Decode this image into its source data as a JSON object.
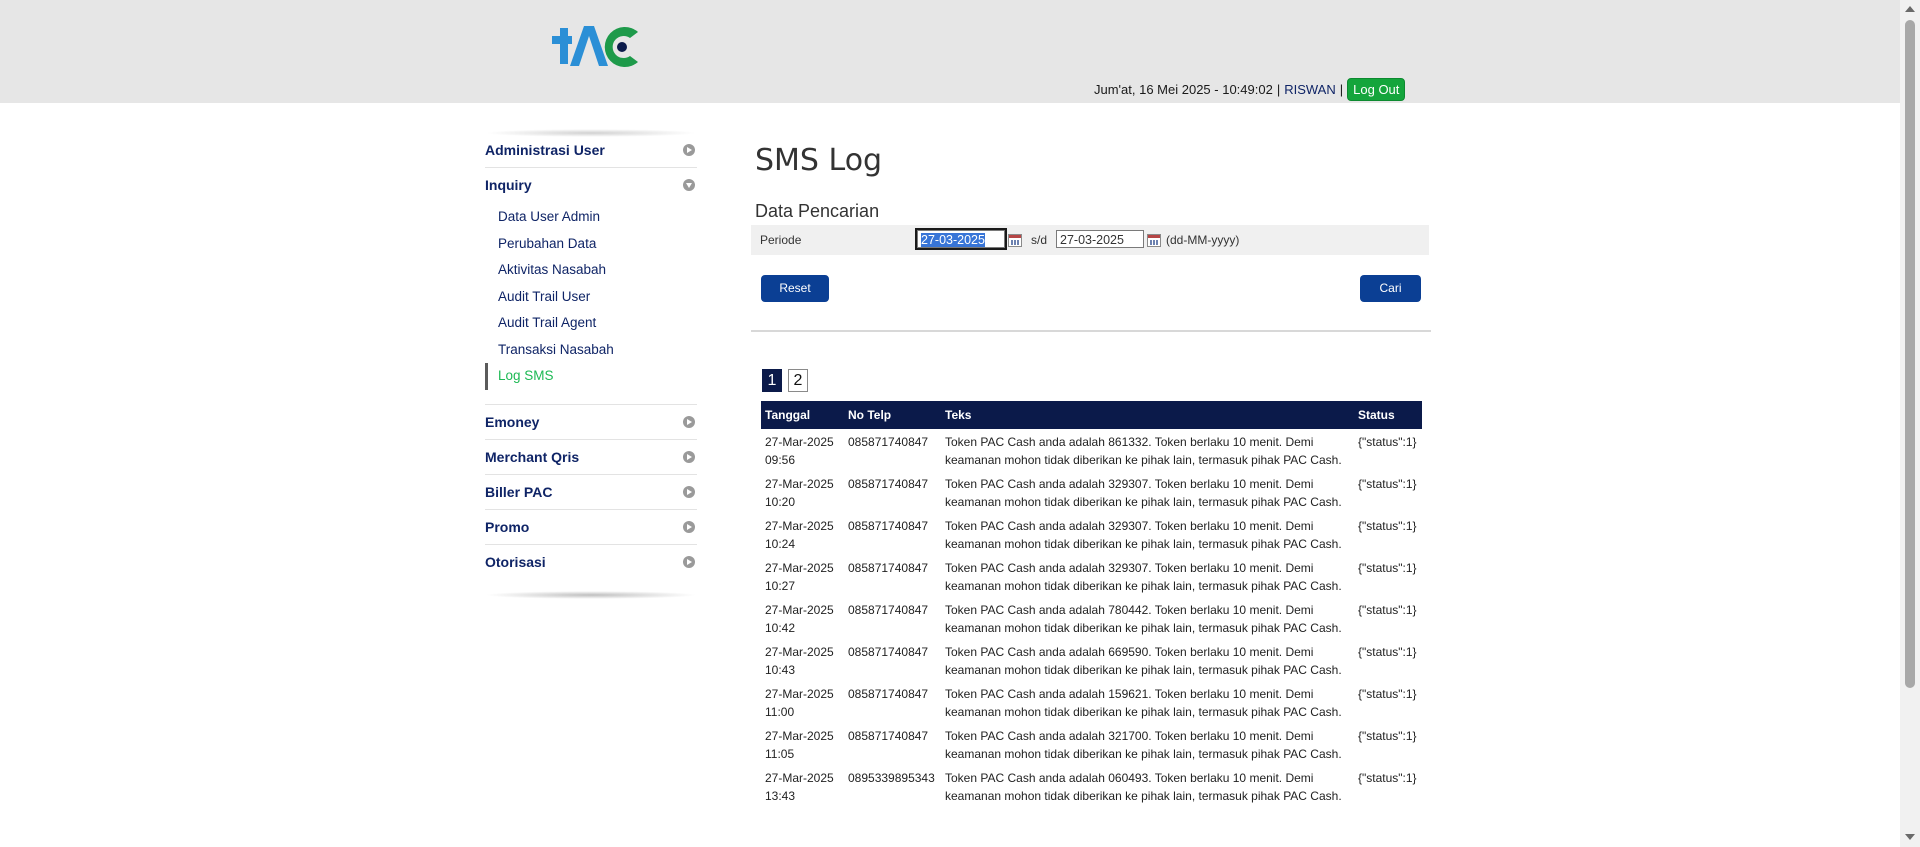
{
  "header": {
    "logo_text": "PAC",
    "datetime": "Jum'at, 16 Mei 2025 - 10:49:02",
    "sep1": "|",
    "username": "RISWAN",
    "sep2": "|",
    "logout_label": "Log Out"
  },
  "sidebar": {
    "menus": [
      {
        "label": "Administrasi User"
      },
      {
        "label": "Inquiry"
      },
      {
        "label": "Emoney"
      },
      {
        "label": "Merchant Qris"
      },
      {
        "label": "Biller PAC"
      },
      {
        "label": "Promo"
      },
      {
        "label": "Otorisasi"
      }
    ],
    "inquiry_items": [
      {
        "label": "Data User Admin"
      },
      {
        "label": "Perubahan Data"
      },
      {
        "label": "Aktivitas Nasabah"
      },
      {
        "label": "Audit Trail User"
      },
      {
        "label": "Audit Trail Agent"
      },
      {
        "label": "Transaksi Nasabah"
      },
      {
        "label": "Log SMS"
      }
    ]
  },
  "main": {
    "title": "SMS Log",
    "section": "Data Pencarian",
    "periode_label": "Periode",
    "date_from": "27-03-2025",
    "sd_label": "s/d",
    "date_to": "27-03-2025",
    "date_format": "(dd-MM-yyyy)",
    "reset_label": "Reset",
    "search_label": "Cari",
    "pages": [
      "1",
      "2"
    ],
    "columns": [
      "Tanggal",
      "No Telp",
      "Teks",
      "Status"
    ],
    "rows": [
      {
        "date1": "27-Mar-2025",
        "date2": "09:56",
        "phone": "085871740847",
        "text1": "Token PAC Cash anda adalah 861332. Token berlaku 10 menit. Demi",
        "text2": "keamanan mohon tidak diberikan ke pihak lain, termasuk pihak PAC Cash.",
        "status": "{\"status\":1}"
      },
      {
        "date1": "27-Mar-2025",
        "date2": "10:20",
        "phone": "085871740847",
        "text1": "Token PAC Cash anda adalah 329307. Token berlaku 10 menit. Demi",
        "text2": "keamanan mohon tidak diberikan ke pihak lain, termasuk pihak PAC Cash.",
        "status": "{\"status\":1}"
      },
      {
        "date1": "27-Mar-2025",
        "date2": "10:24",
        "phone": "085871740847",
        "text1": "Token PAC Cash anda adalah 329307. Token berlaku 10 menit. Demi",
        "text2": "keamanan mohon tidak diberikan ke pihak lain, termasuk pihak PAC Cash.",
        "status": "{\"status\":1}"
      },
      {
        "date1": "27-Mar-2025",
        "date2": "10:27",
        "phone": "085871740847",
        "text1": "Token PAC Cash anda adalah 329307. Token berlaku 10 menit. Demi",
        "text2": "keamanan mohon tidak diberikan ke pihak lain, termasuk pihak PAC Cash.",
        "status": "{\"status\":1}"
      },
      {
        "date1": "27-Mar-2025",
        "date2": "10:42",
        "phone": "085871740847",
        "text1": "Token PAC Cash anda adalah 780442. Token berlaku 10 menit. Demi",
        "text2": "keamanan mohon tidak diberikan ke pihak lain, termasuk pihak PAC Cash.",
        "status": "{\"status\":1}"
      },
      {
        "date1": "27-Mar-2025",
        "date2": "10:43",
        "phone": "085871740847",
        "text1": "Token PAC Cash anda adalah 669590. Token berlaku 10 menit. Demi",
        "text2": "keamanan mohon tidak diberikan ke pihak lain, termasuk pihak PAC Cash.",
        "status": "{\"status\":1}"
      },
      {
        "date1": "27-Mar-2025",
        "date2": "11:00",
        "phone": "085871740847",
        "text1": "Token PAC Cash anda adalah 159621. Token berlaku 10 menit. Demi",
        "text2": "keamanan mohon tidak diberikan ke pihak lain, termasuk pihak PAC Cash.",
        "status": "{\"status\":1}"
      },
      {
        "date1": "27-Mar-2025",
        "date2": "11:05",
        "phone": "085871740847",
        "text1": "Token PAC Cash anda adalah 321700. Token berlaku 10 menit. Demi",
        "text2": "keamanan mohon tidak diberikan ke pihak lain, termasuk pihak PAC Cash.",
        "status": "{\"status\":1}"
      },
      {
        "date1": "27-Mar-2025",
        "date2": "13:43",
        "phone": "0895339895343",
        "text1": "Token PAC Cash anda adalah 060493. Token berlaku 10 menit. Demi",
        "text2": "keamanan mohon tidak diberikan ke pihak lain, termasuk pihak PAC Cash.",
        "status": "{\"status\":1}"
      }
    ]
  },
  "colors": {
    "navy": "#0b1a4a",
    "button_blue": "#0b3f94",
    "active_green": "#1db954",
    "logout_green": "#14a53c"
  }
}
